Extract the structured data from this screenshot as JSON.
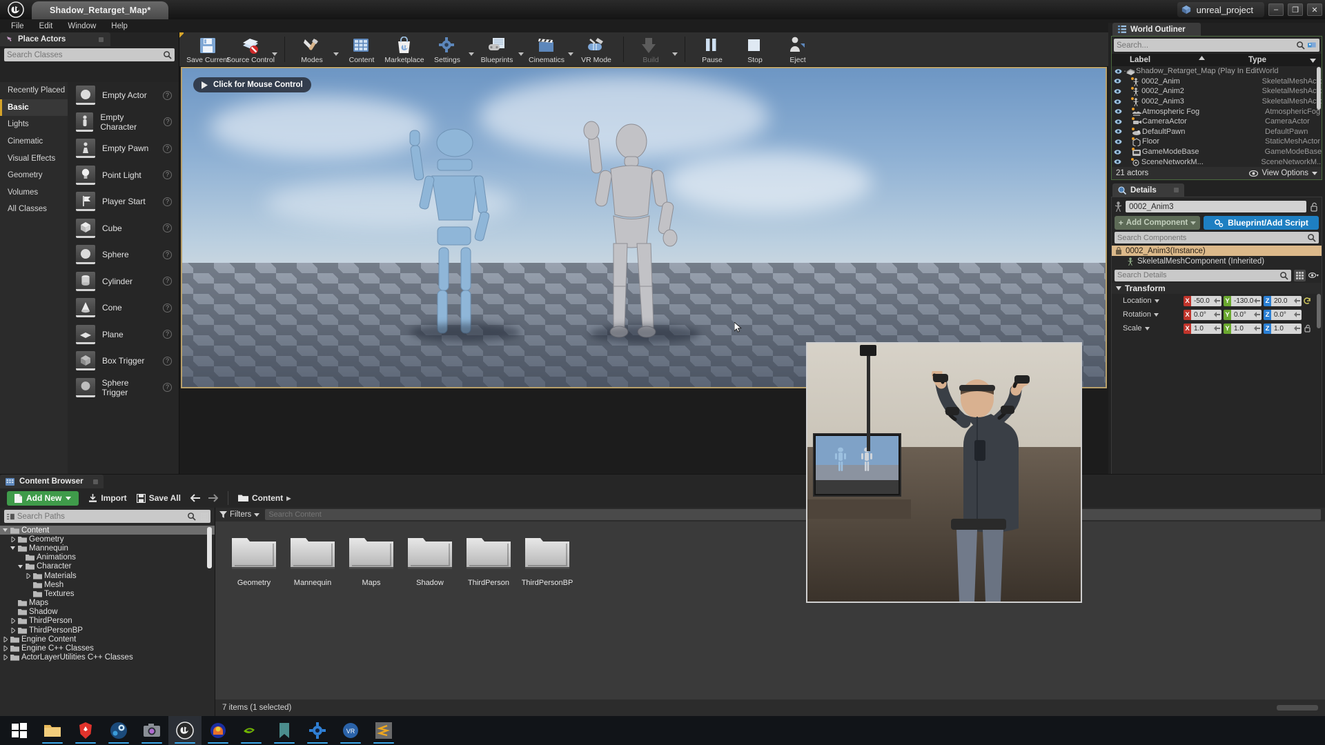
{
  "titlebar": {
    "doc_tab": "Shadow_Retarget_Map*",
    "project_name": "unreal_project",
    "minimize": "–",
    "maximize": "❐",
    "close": "✕",
    "logo_icon": "unreal-logo-icon"
  },
  "menubar": {
    "items": [
      "File",
      "Edit",
      "Window",
      "Help"
    ]
  },
  "place_actors": {
    "tab_title": "Place Actors",
    "search_placeholder": "Search Classes",
    "categories": [
      {
        "label": "Recently Placed",
        "selected": false
      },
      {
        "label": "Basic",
        "selected": true
      },
      {
        "label": "Lights",
        "selected": false
      },
      {
        "label": "Cinematic",
        "selected": false
      },
      {
        "label": "Visual Effects",
        "selected": false
      },
      {
        "label": "Geometry",
        "selected": false
      },
      {
        "label": "Volumes",
        "selected": false
      },
      {
        "label": "All Classes",
        "selected": false
      }
    ],
    "actors": [
      {
        "label": "Empty Actor",
        "icon": "sphere-thumb-icon"
      },
      {
        "label": "Empty Character",
        "icon": "character-thumb-icon"
      },
      {
        "label": "Empty Pawn",
        "icon": "pawn-thumb-icon"
      },
      {
        "label": "Point Light",
        "icon": "bulb-thumb-icon"
      },
      {
        "label": "Player Start",
        "icon": "flag-thumb-icon"
      },
      {
        "label": "Cube",
        "icon": "cube-thumb-icon"
      },
      {
        "label": "Sphere",
        "icon": "sphere-thumb-icon"
      },
      {
        "label": "Cylinder",
        "icon": "cylinder-thumb-icon"
      },
      {
        "label": "Cone",
        "icon": "cone-thumb-icon"
      },
      {
        "label": "Plane",
        "icon": "plane-thumb-icon"
      },
      {
        "label": "Box Trigger",
        "icon": "box-trigger-thumb-icon"
      },
      {
        "label": "Sphere Trigger",
        "icon": "sphere-trigger-thumb-icon"
      }
    ],
    "help_glyph": "?"
  },
  "toolbar": {
    "buttons": [
      {
        "label": "Save Current",
        "icon": "save-icon",
        "dropdown": false,
        "disabled": false
      },
      {
        "label": "Source Control",
        "icon": "source-control-icon",
        "dropdown": true,
        "disabled": false
      },
      {
        "label": "Modes",
        "icon": "modes-icon",
        "dropdown": true,
        "disabled": false
      },
      {
        "label": "Content",
        "icon": "content-icon",
        "dropdown": false,
        "disabled": false
      },
      {
        "label": "Marketplace",
        "icon": "marketplace-icon",
        "dropdown": false,
        "disabled": false
      },
      {
        "label": "Settings",
        "icon": "settings-gear-icon",
        "dropdown": true,
        "disabled": false
      },
      {
        "label": "Blueprints",
        "icon": "blueprints-icon",
        "dropdown": true,
        "disabled": false
      },
      {
        "label": "Cinematics",
        "icon": "cinematics-clapper-icon",
        "dropdown": true,
        "disabled": false
      },
      {
        "label": "VR Mode",
        "icon": "vr-mode-icon",
        "dropdown": false,
        "disabled": false
      },
      {
        "label": "Build",
        "icon": "build-icon",
        "dropdown": true,
        "disabled": true
      },
      {
        "label": "Pause",
        "icon": "pause-icon",
        "dropdown": false,
        "disabled": false
      },
      {
        "label": "Stop",
        "icon": "stop-icon",
        "dropdown": false,
        "disabled": false
      },
      {
        "label": "Eject",
        "icon": "eject-person-icon",
        "dropdown": false,
        "disabled": false
      }
    ]
  },
  "viewport": {
    "mouse_control_label": "Click for Mouse Control",
    "play_arrow_icon": "play-triangle-icon",
    "cursor_icon": "mouse-cursor-icon"
  },
  "world_outliner": {
    "tab_title": "World Outliner",
    "tab_icon": "outliner-list-icon",
    "search_placeholder": "Search...",
    "add_icon": "add-outliner-icon",
    "columns": {
      "label": "Label",
      "type": "Type"
    },
    "sort_asc_icon": "sort-ascending-icon",
    "rows": [
      {
        "label": "Shadow_Retarget_Map (Play In Edito",
        "type": "World",
        "icon": "world-icon",
        "indent": 0,
        "is_world": true
      },
      {
        "label": "0002_Anim",
        "type": "SkeletalMeshActo",
        "icon": "skeletal-mesh-icon",
        "indent": 1,
        "is_world": false
      },
      {
        "label": "0002_Anim2",
        "type": "SkeletalMeshActo",
        "icon": "skeletal-mesh-icon",
        "indent": 1,
        "is_world": false
      },
      {
        "label": "0002_Anim3",
        "type": "SkeletalMeshActo",
        "icon": "skeletal-mesh-icon",
        "indent": 1,
        "is_world": false
      },
      {
        "label": "Atmospheric Fog",
        "type": "AtmosphericFog",
        "icon": "fog-icon",
        "indent": 1,
        "is_world": false
      },
      {
        "label": "CameraActor",
        "type": "CameraActor",
        "icon": "camera-icon",
        "indent": 1,
        "is_world": false
      },
      {
        "label": "DefaultPawn",
        "type": "DefaultPawn",
        "icon": "pawn-icon",
        "indent": 1,
        "is_world": false
      },
      {
        "label": "Floor",
        "type": "StaticMeshActor",
        "icon": "static-mesh-icon",
        "indent": 1,
        "is_world": false
      },
      {
        "label": "GameModeBase",
        "type": "GameModeBase",
        "icon": "gamemode-icon",
        "indent": 1,
        "is_world": false
      },
      {
        "label": "SceneNetworkM...",
        "type": "SceneNetworkM...",
        "icon": "scene-icon",
        "indent": 1,
        "is_world": false
      }
    ],
    "footer": {
      "count": "21 actors",
      "view_options": "View Options",
      "eye_icon": "eye-icon"
    }
  },
  "details": {
    "tab_title": "Details",
    "tab_icon": "details-magnifier-icon",
    "actor_name": "0002_Anim3",
    "lock_icon": "unlock-icon",
    "add_component": "Add Component",
    "blueprint_button": "Blueprint/Add Script",
    "blueprint_icon": "blueprint-gears-icon",
    "search_components_placeholder": "Search Components",
    "components": [
      {
        "label": "0002_Anim3(Instance)",
        "selected": true,
        "icon": "instance-icon"
      },
      {
        "label": "SkeletalMeshComponent (Inherited)",
        "selected": false,
        "icon": "skeletal-component-icon"
      }
    ],
    "search_details_placeholder": "Search Details",
    "grid_view_icon": "grid-view-icon",
    "eye_dropdown_icon": "eye-dropdown-icon",
    "transform": {
      "section_title": "Transform",
      "rows": [
        {
          "label": "Location",
          "x": "-50.0",
          "y": "-130.0",
          "z": "20.0",
          "reset": true
        },
        {
          "label": "Rotation",
          "x": "0.0°",
          "y": "0.0°",
          "z": "0.0°",
          "reset": false
        },
        {
          "label": "Scale",
          "x": "1.0",
          "y": "1.0",
          "z": "1.0",
          "reset": false
        }
      ],
      "axis_keys": [
        "X",
        "Y",
        "Z"
      ],
      "reset_icon": "reset-arrow-icon",
      "lock_ratio_icon": "lock-ratio-icon"
    }
  },
  "content_browser": {
    "tab_title": "Content Browser",
    "tab_icon": "content-browser-icon",
    "add_new": "Add New",
    "import": "Import",
    "save_all": "Save All",
    "breadcrumb": "Content",
    "back_icon": "arrow-left-icon",
    "forward_icon": "arrow-right-icon",
    "folder_icon": "folder-icon",
    "breadcrumb_caret": "▸",
    "paths_placeholder": "Search Paths",
    "content_placeholder": "Search Content",
    "filters_label": "Filters",
    "tree": [
      {
        "label": "Content",
        "depth": 0,
        "twisty": "down",
        "selected": true
      },
      {
        "label": "Geometry",
        "depth": 1,
        "twisty": "right",
        "selected": false
      },
      {
        "label": "Mannequin",
        "depth": 1,
        "twisty": "down",
        "selected": false
      },
      {
        "label": "Animations",
        "depth": 2,
        "twisty": "none",
        "selected": false
      },
      {
        "label": "Character",
        "depth": 2,
        "twisty": "down",
        "selected": false
      },
      {
        "label": "Materials",
        "depth": 3,
        "twisty": "right",
        "selected": false
      },
      {
        "label": "Mesh",
        "depth": 3,
        "twisty": "none",
        "selected": false
      },
      {
        "label": "Textures",
        "depth": 3,
        "twisty": "none",
        "selected": false
      },
      {
        "label": "Maps",
        "depth": 1,
        "twisty": "none",
        "selected": false
      },
      {
        "label": "Shadow",
        "depth": 1,
        "twisty": "none",
        "selected": false
      },
      {
        "label": "ThirdPerson",
        "depth": 1,
        "twisty": "right",
        "selected": false
      },
      {
        "label": "ThirdPersonBP",
        "depth": 1,
        "twisty": "right",
        "selected": false
      },
      {
        "label": "Engine Content",
        "depth": 0,
        "twisty": "right",
        "selected": false
      },
      {
        "label": "Engine C++ Classes",
        "depth": 0,
        "twisty": "right",
        "selected": false
      },
      {
        "label": "ActorLayerUtilities C++ Classes",
        "depth": 0,
        "twisty": "right",
        "selected": false
      }
    ],
    "folders": [
      "Geometry",
      "Mannequin",
      "Maps",
      "Shadow",
      "ThirdPerson",
      "ThirdPersonBP"
    ],
    "status": "7 items (1 selected)"
  },
  "webcam": {
    "label": "mocap-webcam-feed"
  },
  "taskbar": {
    "items": [
      {
        "name": "start-button",
        "icon": "windows-logo-icon",
        "active": false,
        "running": false
      },
      {
        "name": "file-explorer",
        "icon": "folder-icon",
        "active": false,
        "running": true
      },
      {
        "name": "brave-browser",
        "icon": "brave-lion-icon",
        "active": false,
        "running": true
      },
      {
        "name": "steam",
        "icon": "steam-icon",
        "active": false,
        "running": true
      },
      {
        "name": "camera-app",
        "icon": "camera-icon",
        "active": false,
        "running": true
      },
      {
        "name": "unreal-engine",
        "icon": "unreal-logo-icon",
        "active": true,
        "running": true
      },
      {
        "name": "audio-app",
        "icon": "headphones-icon",
        "active": false,
        "running": true
      },
      {
        "name": "nvidia-app",
        "icon": "nvidia-eye-icon",
        "active": false,
        "running": true
      },
      {
        "name": "bookmark-app",
        "icon": "bookmark-icon",
        "active": false,
        "running": true
      },
      {
        "name": "settings-app",
        "icon": "gear-icon",
        "active": false,
        "running": true
      },
      {
        "name": "vr-app",
        "icon": "vr-icon",
        "active": false,
        "running": true
      },
      {
        "name": "sublime-text",
        "icon": "sublime-icon",
        "active": false,
        "running": true
      }
    ]
  }
}
